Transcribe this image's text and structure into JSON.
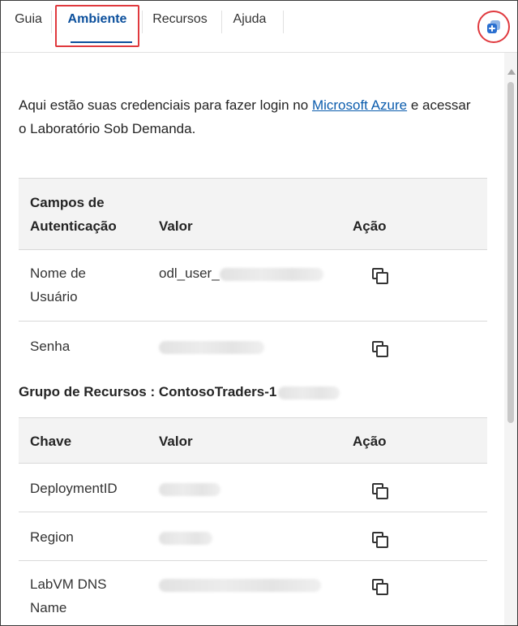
{
  "tabs": [
    {
      "label": "Guia"
    },
    {
      "label": "Ambiente"
    },
    {
      "label": "Recursos"
    },
    {
      "label": "Ajuda"
    }
  ],
  "active_tab": "Ambiente",
  "intro": {
    "before_link": "Aqui estão suas credenciais para fazer login no ",
    "link_text": "Microsoft Azure",
    "after_link": " e acessar o Laboratório Sob Demanda."
  },
  "auth_table": {
    "headers": [
      "Campos de Autenticação",
      "Valor",
      "Ação"
    ],
    "rows": [
      {
        "field": "Nome de Usuário",
        "value": "odl_user_"
      },
      {
        "field": "Senha",
        "value": ""
      }
    ]
  },
  "resource_group": {
    "title": "Grupo de Recursos : ContosoTraders-1"
  },
  "resource_table": {
    "headers": [
      "Chave",
      "Valor",
      "Ação"
    ],
    "rows": [
      {
        "key": "DeploymentID",
        "value": ""
      },
      {
        "key": "Region",
        "value": ""
      },
      {
        "key": "LabVM DNS Name",
        "value": ""
      }
    ]
  },
  "colors": {
    "accent": "#0b4f9c",
    "highlight": "#e0393e",
    "link": "#0b5cad",
    "header_bg": "#f3f3f3"
  },
  "icons": {
    "copy": "copy-icon",
    "expand": "open-in-new-window-icon"
  }
}
